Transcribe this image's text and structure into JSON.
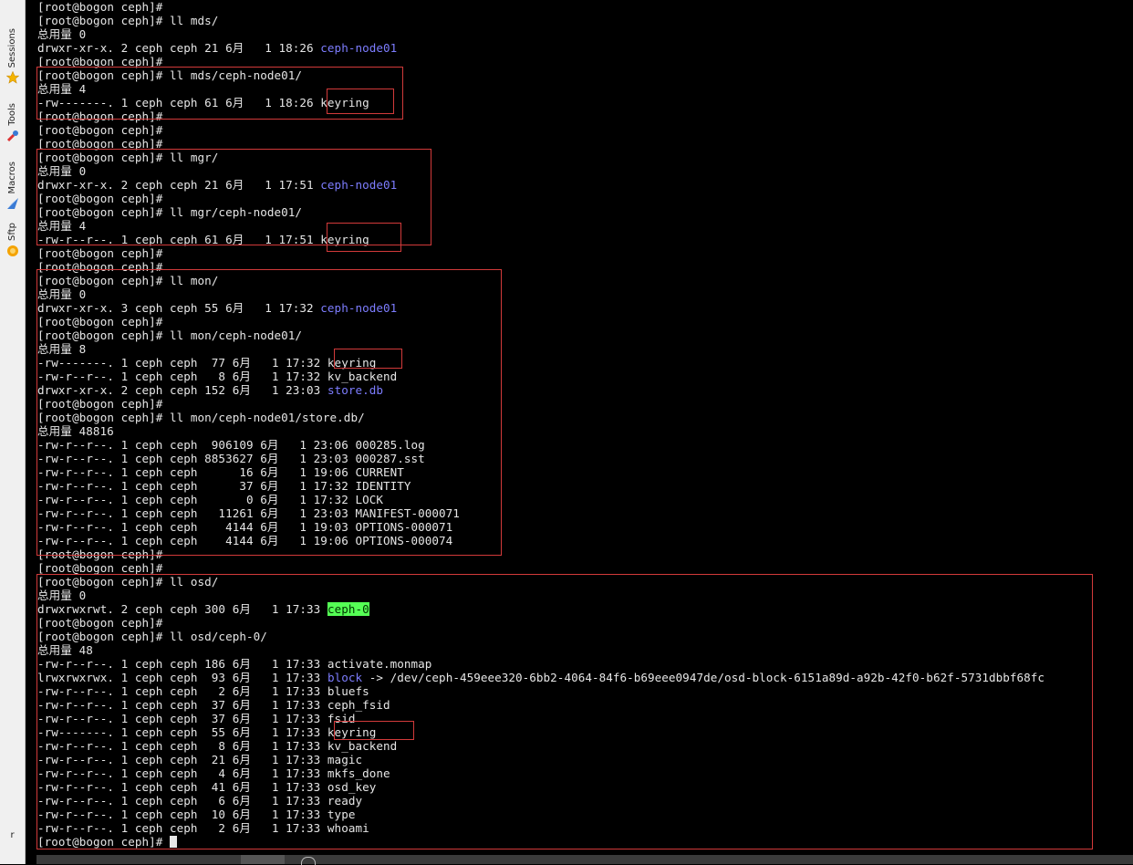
{
  "sidebar": {
    "tabs": [
      {
        "label": "Sessions",
        "icon": "star-icon"
      },
      {
        "label": "Tools",
        "icon": "tools-icon"
      },
      {
        "label": "Macros",
        "icon": "macros-icon"
      },
      {
        "label": "Sftp",
        "icon": "sftp-icon"
      }
    ],
    "bottom_label": "r"
  },
  "colors": {
    "background": "#000000",
    "text": "#e6e6e6",
    "directory": "#7d7dff",
    "highlight_bg": "#55ff55",
    "highlight_fg": "#003300",
    "annotation_box": "#d23a3a"
  },
  "terminal": {
    "lines": [
      {
        "text": "[root@bogon ceph]#"
      },
      {
        "text": "[root@bogon ceph]# ll mds/"
      },
      {
        "text": "总用量 0"
      },
      {
        "text": "drwxr-xr-x. 2 ceph ceph 21 6月   1 18:26 ",
        "link": "ceph-node01"
      },
      {
        "text": "[root@bogon ceph]#"
      },
      {
        "text": "[root@bogon ceph]# ll mds/ceph-node01/"
      },
      {
        "text": "总用量 4"
      },
      {
        "text": "-rw-------. 1 ceph ceph 61 6月   1 18:26 keyring"
      },
      {
        "text": "[root@bogon ceph]#"
      },
      {
        "text": "[root@bogon ceph]#"
      },
      {
        "text": "[root@bogon ceph]#"
      },
      {
        "text": "[root@bogon ceph]# ll mgr/"
      },
      {
        "text": "总用量 0"
      },
      {
        "text": "drwxr-xr-x. 2 ceph ceph 21 6月   1 17:51 ",
        "link": "ceph-node01"
      },
      {
        "text": "[root@bogon ceph]#"
      },
      {
        "text": "[root@bogon ceph]# ll mgr/ceph-node01/"
      },
      {
        "text": "总用量 4"
      },
      {
        "text": "-rw-r--r--. 1 ceph ceph 61 6月   1 17:51 keyring"
      },
      {
        "text": "[root@bogon ceph]#"
      },
      {
        "text": "[root@bogon ceph]#"
      },
      {
        "text": "[root@bogon ceph]# ll mon/"
      },
      {
        "text": "总用量 0"
      },
      {
        "text": "drwxr-xr-x. 3 ceph ceph 55 6月   1 17:32 ",
        "link": "ceph-node01"
      },
      {
        "text": "[root@bogon ceph]#"
      },
      {
        "text": "[root@bogon ceph]# ll mon/ceph-node01/"
      },
      {
        "text": "总用量 8"
      },
      {
        "text": "-rw-------. 1 ceph ceph  77 6月   1 17:32 keyring"
      },
      {
        "text": "-rw-r--r--. 1 ceph ceph   8 6月   1 17:32 kv_backend"
      },
      {
        "text": "drwxr-xr-x. 2 ceph ceph 152 6月   1 23:03 ",
        "link": "store.db"
      },
      {
        "text": "[root@bogon ceph]#"
      },
      {
        "text": "[root@bogon ceph]# ll mon/ceph-node01/store.db/"
      },
      {
        "text": "总用量 48816"
      },
      {
        "text": "-rw-r--r--. 1 ceph ceph  906109 6月   1 23:06 000285.log"
      },
      {
        "text": "-rw-r--r--. 1 ceph ceph 8853627 6月   1 23:03 000287.sst"
      },
      {
        "text": "-rw-r--r--. 1 ceph ceph      16 6月   1 19:06 CURRENT"
      },
      {
        "text": "-rw-r--r--. 1 ceph ceph      37 6月   1 17:32 IDENTITY"
      },
      {
        "text": "-rw-r--r--. 1 ceph ceph       0 6月   1 17:32 LOCK"
      },
      {
        "text": "-rw-r--r--. 1 ceph ceph   11261 6月   1 23:03 MANIFEST-000071"
      },
      {
        "text": "-rw-r--r--. 1 ceph ceph    4144 6月   1 19:03 OPTIONS-000071"
      },
      {
        "text": "-rw-r--r--. 1 ceph ceph    4144 6月   1 19:06 OPTIONS-000074"
      },
      {
        "text": "[root@bogon ceph]#"
      },
      {
        "text": "[root@bogon ceph]#"
      },
      {
        "text": "[root@bogon ceph]# ll osd/"
      },
      {
        "text": "总用量 0"
      },
      {
        "text": "drwxrwxrwt. 2 ceph ceph 300 6月   1 17:33 ",
        "highlight": "ceph-0"
      },
      {
        "text": "[root@bogon ceph]#"
      },
      {
        "text": "[root@bogon ceph]# ll osd/ceph-0/"
      },
      {
        "text": "总用量 48"
      },
      {
        "text": "-rw-r--r--. 1 ceph ceph 186 6月   1 17:33 activate.monmap"
      },
      {
        "text": "lrwxrwxrwx. 1 ceph ceph  93 6月   1 17:33 ",
        "link": "block",
        "suffix": " -> /dev/ceph-459eee320-6bb2-4064-84f6-b69eee0947de/osd-block-6151a89d-a92b-42f0-b62f-5731dbbf68fc"
      },
      {
        "text": "-rw-r--r--. 1 ceph ceph   2 6月   1 17:33 bluefs"
      },
      {
        "text": "-rw-r--r--. 1 ceph ceph  37 6月   1 17:33 ceph_fsid"
      },
      {
        "text": "-rw-r--r--. 1 ceph ceph  37 6月   1 17:33 fsid"
      },
      {
        "text": "-rw-------. 1 ceph ceph  55 6月   1 17:33 keyring"
      },
      {
        "text": "-rw-r--r--. 1 ceph ceph   8 6月   1 17:33 kv_backend"
      },
      {
        "text": "-rw-r--r--. 1 ceph ceph  21 6月   1 17:33 magic"
      },
      {
        "text": "-rw-r--r--. 1 ceph ceph   4 6月   1 17:33 mkfs_done"
      },
      {
        "text": "-rw-r--r--. 1 ceph ceph  41 6月   1 17:33 osd_key"
      },
      {
        "text": "-rw-r--r--. 1 ceph ceph   6 6月   1 17:33 ready"
      },
      {
        "text": "-rw-r--r--. 1 ceph ceph  10 6月   1 17:33 type"
      },
      {
        "text": "-rw-r--r--. 1 ceph ceph   2 6月   1 17:33 whoami"
      },
      {
        "text": "[root@bogon ceph]# ",
        "cursor": true
      }
    ]
  }
}
